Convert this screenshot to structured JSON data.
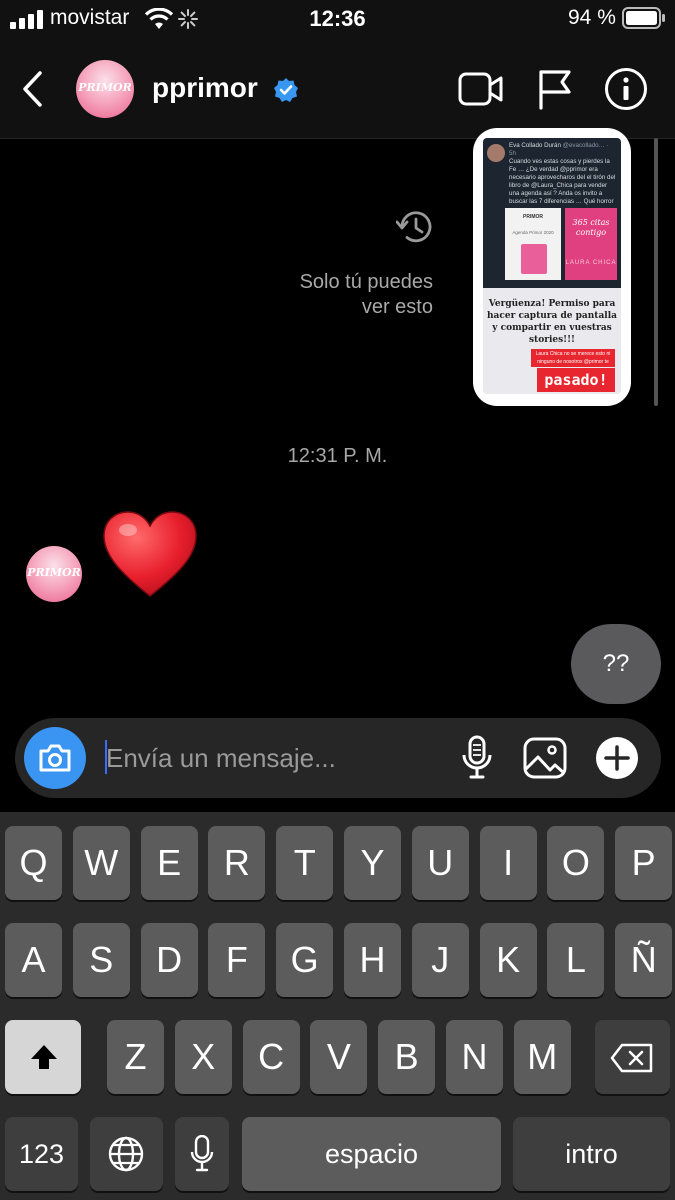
{
  "status_bar": {
    "carrier": "movistar",
    "time": "12:36",
    "battery": "94 %"
  },
  "header": {
    "username": "pprimor",
    "avatar_text": "PRIMOR"
  },
  "story": {
    "tweet_author": "Eva Collado Durán",
    "tweet_handle": "@evacollado… · 5h",
    "tweet_text": "Cuando ves estas cosas y pierdes la Fe … ¿De verdad @pprimor era necesario aprovecharos del el tirón del libro de @Laura_Chica para vender una agenda así ? Anda os invito a buscar las 7 diferencias … Qué horror …",
    "img_left_title": "PRIMOR",
    "img_left_caption": "Agenda Primor 2020",
    "img_right_title": "365 citas contigo",
    "img_right_author": "LAURA CHICA",
    "shame_text": "Vergüenza! Permiso para hacer captura de pantalla y compartir en vuestras stories!!!",
    "red_strip_text": "Laura Chica no se merece esto ni ninguno de nosotros @primor te has",
    "pasado_text": "pasado!"
  },
  "only_you_line1": "Solo tú puedes",
  "only_you_line2": "ver esto",
  "timestamp": "12:31 P. M.",
  "heart_emoji": "❤️",
  "outgoing_message": "??",
  "composer": {
    "placeholder": "Envía un mensaje..."
  },
  "keyboard": {
    "row1": [
      "Q",
      "W",
      "E",
      "R",
      "T",
      "Y",
      "U",
      "I",
      "O",
      "P"
    ],
    "row2": [
      "A",
      "S",
      "D",
      "F",
      "G",
      "H",
      "J",
      "K",
      "L",
      "Ñ"
    ],
    "row3": [
      "Z",
      "X",
      "C",
      "V",
      "B",
      "N",
      "M"
    ],
    "numbers": "123",
    "space": "espacio",
    "return": "intro"
  },
  "colors": {
    "background": "#000000",
    "composer_bg": "#262626",
    "camera_button": "#3a94f2",
    "verified_badge": "#3897f0",
    "outgoing_bubble": "#5a5a5c",
    "key": "#5c5c5c",
    "key_dark": "#3e3e3e"
  },
  "icons": [
    "signal-icon",
    "wifi-icon",
    "activity-spinner-icon",
    "battery-icon",
    "back-chevron-icon",
    "verified-badge-icon",
    "video-call-icon",
    "flag-icon",
    "info-icon",
    "history-icon",
    "camera-icon",
    "microphone-icon",
    "gallery-icon",
    "plus-icon",
    "shift-icon",
    "delete-icon",
    "globe-icon",
    "dictation-icon"
  ]
}
